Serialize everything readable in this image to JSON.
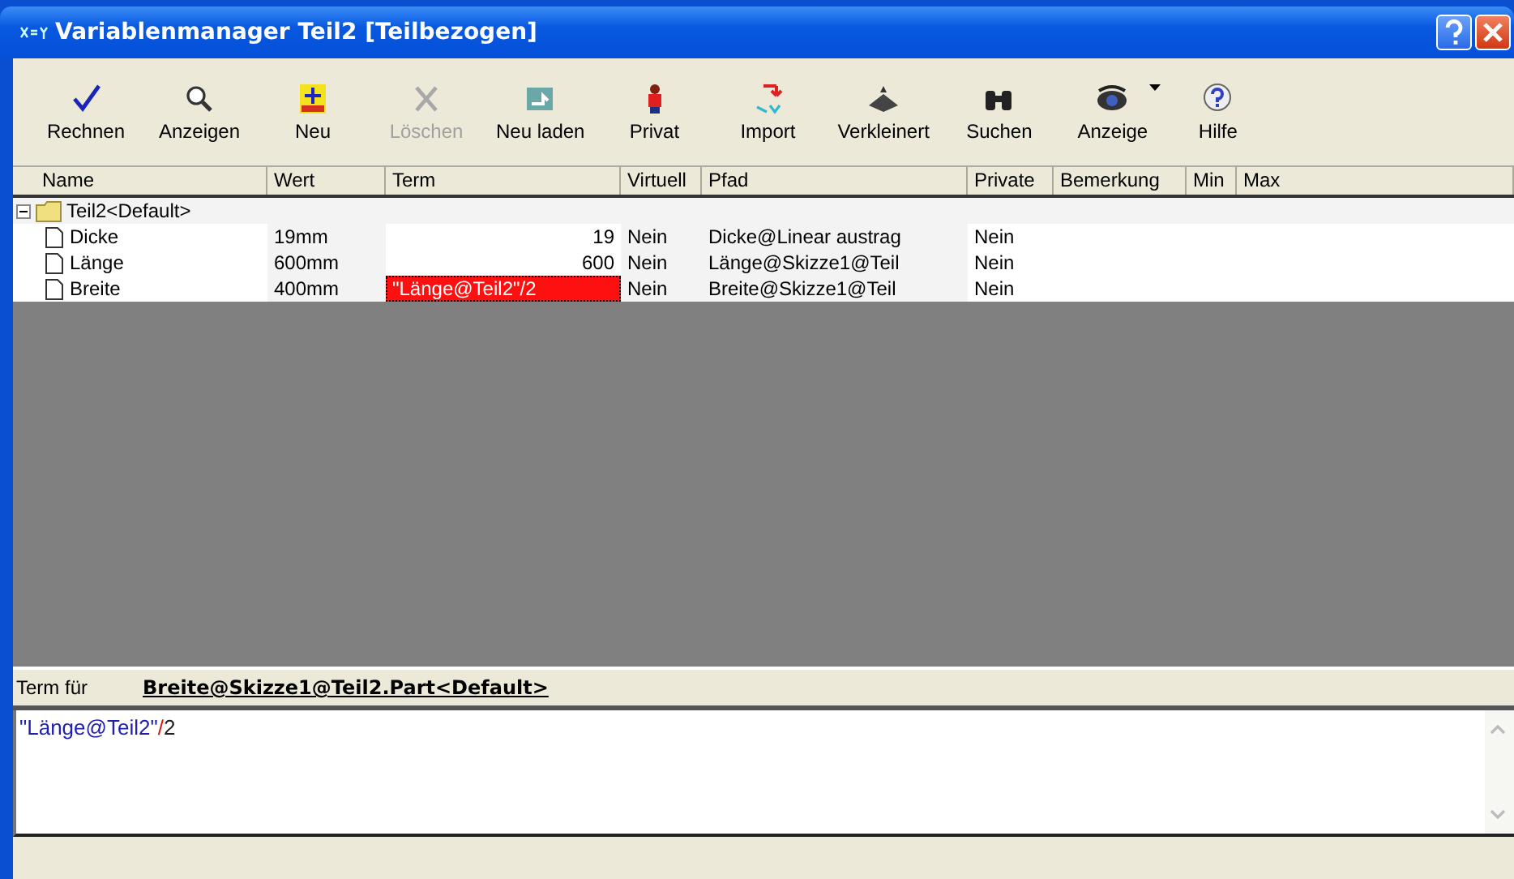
{
  "window": {
    "title": "Variablenmanager Teil2 [Teilbezogen]"
  },
  "toolbar": [
    {
      "label": "Rechnen",
      "disabled": false
    },
    {
      "label": "Anzeigen",
      "disabled": false
    },
    {
      "label": "Neu",
      "disabled": false
    },
    {
      "label": "Löschen",
      "disabled": true
    },
    {
      "label": "Neu laden",
      "disabled": false
    },
    {
      "label": "Privat",
      "disabled": false
    },
    {
      "label": "Import",
      "disabled": false
    },
    {
      "label": "Verkleinert",
      "disabled": false
    },
    {
      "label": "Suchen",
      "disabled": false
    },
    {
      "label": "Anzeige",
      "disabled": false
    },
    {
      "label": "Hilfe",
      "disabled": false
    }
  ],
  "table": {
    "columns": [
      "Name",
      "Wert",
      "Term",
      "Virtuell",
      "Pfad",
      "Private",
      "Bemerkung",
      "Min",
      "Max"
    ],
    "tree": [
      {
        "name": "Teil2<Default>",
        "expanded": true,
        "children": [
          {
            "name": "Dicke",
            "value": "19mm",
            "term": "19",
            "kind": "number",
            "virtual": "Nein",
            "path": "Dicke@Linear austrag",
            "private": "Nein",
            "selected": false
          },
          {
            "name": "Länge",
            "value": "600mm",
            "term": "600",
            "kind": "number",
            "virtual": "Nein",
            "path": "Länge@Skizze1@Teil",
            "private": "Nein",
            "selected": false
          },
          {
            "name": "Breite",
            "value": "400mm",
            "term": "\"Länge@Teil2\"/2",
            "kind": "formula",
            "virtual": "Nein",
            "path": "Breite@Skizze1@Teil",
            "private": "Nein",
            "selected": true
          }
        ]
      }
    ]
  },
  "term_editor": {
    "label": "Term für",
    "target": "Breite@Skizze1@Teil2.Part<Default>",
    "tokens": [
      {
        "text": "\"Länge@Teil2\"",
        "kind": "string"
      },
      {
        "text": "/",
        "kind": "operator"
      },
      {
        "text": "2",
        "kind": "number"
      }
    ]
  }
}
